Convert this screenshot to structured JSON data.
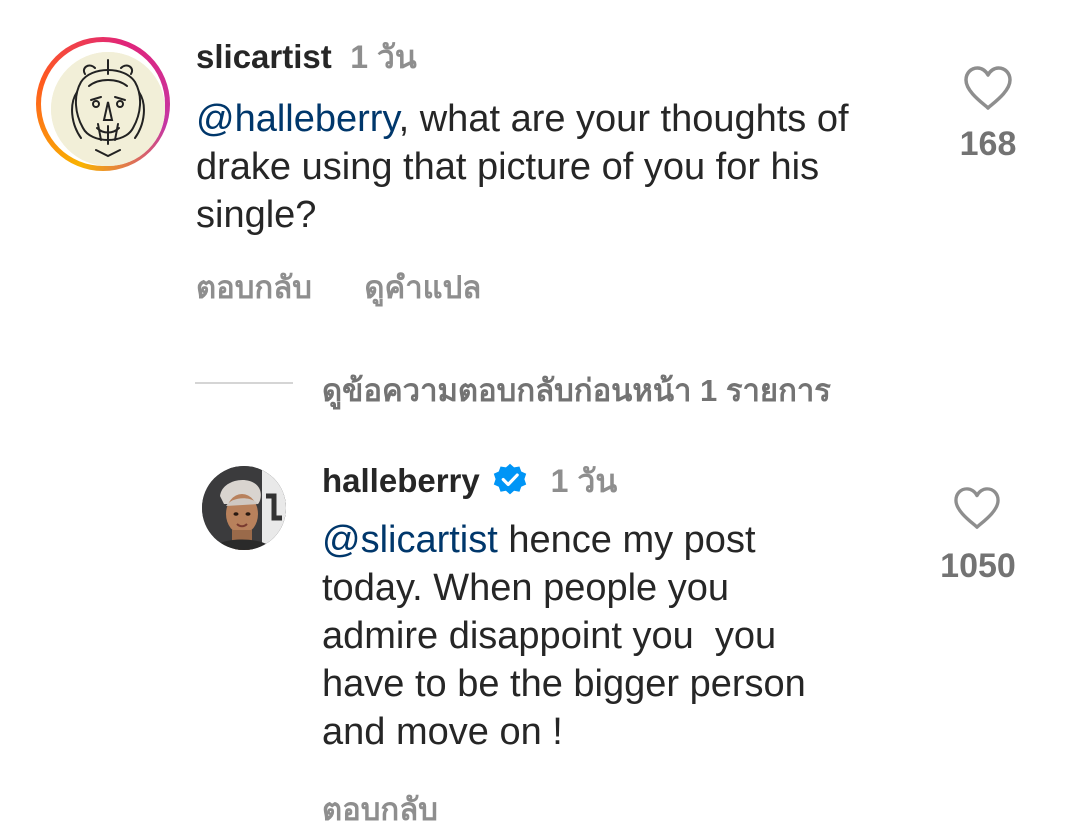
{
  "comment": {
    "username": "slicartist",
    "timestamp": "1 วัน",
    "mention": "@halleberry",
    "text_line1_rest": ", what are your thoughts of",
    "text_line2": "drake using that picture of you for his",
    "text_line3": "single?",
    "like_count": "168",
    "reply_label": "ตอบกลับ",
    "translate_label": "ดูคำแปล"
  },
  "view_previous_replies": "ดูข้อความตอบกลับก่อนหน้า 1 รายการ",
  "reply": {
    "username": "halleberry",
    "timestamp": "1 วัน",
    "mention": "@slicartist",
    "text_line1_rest": " hence my post",
    "text_line2": "today. When people you",
    "text_line3": "admire disappoint you  you",
    "text_line4": "have to be the bigger person",
    "text_line5": "and move on !",
    "like_count": "1050",
    "reply_label": "ตอบกลับ"
  },
  "colors": {
    "mention": "#00376b",
    "verified": "#0095f6",
    "secondary_text": "#8e8e8e"
  },
  "icons": [
    "heart-outline-icon",
    "verified-badge-icon"
  ]
}
